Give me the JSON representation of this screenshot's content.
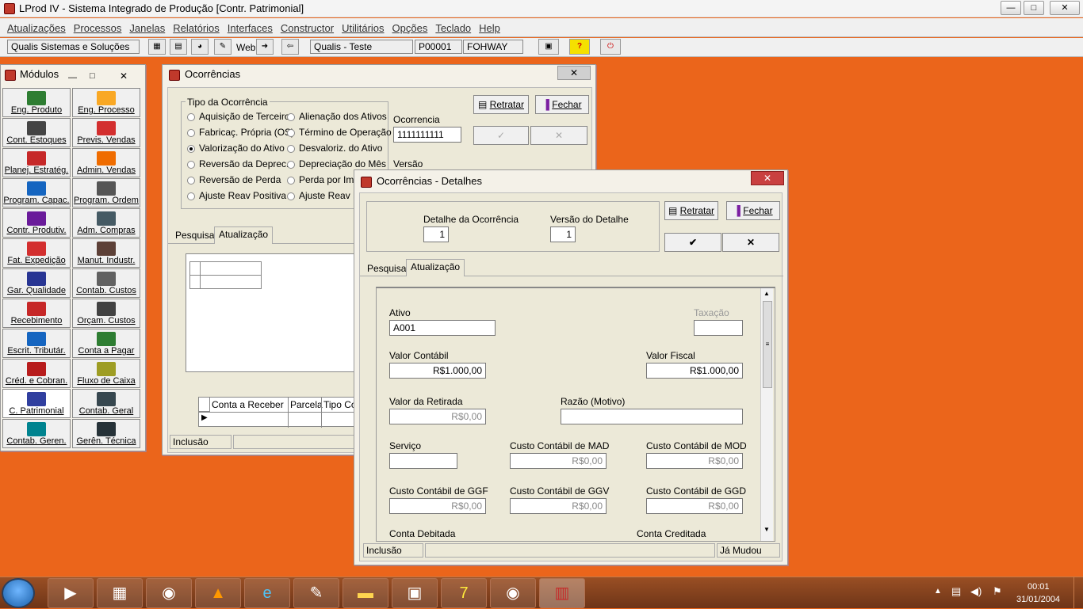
{
  "app": {
    "title": "LProd IV - Sistema Integrado de Produção [Contr. Patrimonial]"
  },
  "menu": [
    "Atualizações",
    "Processos",
    "Janelas",
    "Relatórios",
    "Interfaces",
    "Constructor",
    "Utilitários",
    "Opções",
    "Teclado",
    "Help"
  ],
  "toolbar": {
    "company": "Qualis Sistemas e Soluções",
    "web_label": "Web",
    "env": "Qualis - Teste",
    "code": "P00001",
    "user": "FOHWAY"
  },
  "modules": {
    "title": "Módulos",
    "items": [
      {
        "label": "Eng. Produto",
        "color": "#2e7d32"
      },
      {
        "label": "Eng. Processo",
        "color": "#f9a825"
      },
      {
        "label": "Cont. Estoques",
        "color": "#444444"
      },
      {
        "label": "Previs. Vendas",
        "color": "#d32f2f"
      },
      {
        "label": "Planej. Estratég.",
        "color": "#c62828"
      },
      {
        "label": "Admin. Vendas",
        "color": "#ef6c00"
      },
      {
        "label": "Program. Capac.",
        "color": "#1565c0"
      },
      {
        "label": "Program. Ordem",
        "color": "#555555"
      },
      {
        "label": "Contr. Produtiv.",
        "color": "#6a1b9a"
      },
      {
        "label": "Adm. Compras",
        "color": "#455a64"
      },
      {
        "label": "Fat. Expedição",
        "color": "#d32f2f"
      },
      {
        "label": "Manut. Industr.",
        "color": "#5d4037"
      },
      {
        "label": "Gar. Qualidade",
        "color": "#283593"
      },
      {
        "label": "Contab. Custos",
        "color": "#616161"
      },
      {
        "label": "Recebimento",
        "color": "#c62828"
      },
      {
        "label": "Orçam. Custos",
        "color": "#424242"
      },
      {
        "label": "Escrit. Tributár.",
        "color": "#1565c0"
      },
      {
        "label": "Conta a Pagar",
        "color": "#2e7d32"
      },
      {
        "label": "Créd. e Cobran.",
        "color": "#b71c1c"
      },
      {
        "label": "Fluxo de Caixa",
        "color": "#9e9d24"
      },
      {
        "label": "C. Patrimonial",
        "color": "#303f9f"
      },
      {
        "label": "Contab. Geral",
        "color": "#37474f"
      },
      {
        "label": "Contab. Geren.",
        "color": "#00838f"
      },
      {
        "label": "Gerên. Técnica",
        "color": "#263238"
      }
    ]
  },
  "ocorrencias": {
    "title": "Ocorrências",
    "group_label": "Tipo da Ocorrência",
    "radios_left": [
      "Aquisição de Terceiro",
      "Fabricaç. Própria (OS)",
      "Valorização do Ativo",
      "Reversão da Deprec.",
      "Reversão de Perda",
      "Ajuste Reav Positiva"
    ],
    "radios_right": [
      "Alienação dos Ativos",
      "Término de Operação",
      "Desvaloriz. do Ativo",
      "Depreciação do Mês",
      "Perda por Imp",
      "Ajuste Reav N"
    ],
    "selected": "Valorização do Ativo",
    "ocorrencia_label": "Ocorrencia",
    "ocorrencia_value": "1111111111",
    "versao_label": "Versão",
    "retratar": "Retratar",
    "fechar": "Fechar",
    "tabs": [
      "Pesquisa",
      "Atualização"
    ],
    "grid_headers": [
      "Conta a Receber",
      "Parcela",
      "Tipo Co"
    ],
    "status": "Inclusão"
  },
  "detalhes": {
    "title": "Ocorrências - Detalhes",
    "detalhe_label": "Detalhe da Ocorrência",
    "detalhe_value": "1",
    "versao_label": "Versão do Detalhe",
    "versao_value": "1",
    "retratar": "Retratar",
    "fechar": "Fechar",
    "ok_symbol": "✔",
    "cancel_symbol": "✕",
    "tabs": [
      "Pesquisa",
      "Atualização"
    ],
    "ativo_label": "Ativo",
    "ativo_value": "A001",
    "taxacao_label": "Taxação",
    "valor_contabil_label": "Valor Contábil",
    "valor_contabil": "R$1.000,00",
    "valor_fiscal_label": "Valor Fiscal",
    "valor_fiscal": "R$1.000,00",
    "valor_retirada_label": "Valor da Retirada",
    "valor_retirada": "R$0,00",
    "razao_label": "Razão (Motivo)",
    "servico_label": "Serviço",
    "mad_label": "Custo Contábil de MAD",
    "mad": "R$0,00",
    "mod_label": "Custo Contábil de MOD",
    "mod": "R$0,00",
    "ggf_label": "Custo Contábil de GGF",
    "ggf": "R$0,00",
    "ggv_label": "Custo Contábil de GGV",
    "ggv": "R$0,00",
    "ggd_label": "Custo Contábil de GGD",
    "ggd": "R$0,00",
    "debitada_label": "Conta Debitada",
    "creditada_label": "Conta Creditada",
    "status": "Inclusão",
    "status_right": "Já Mudou"
  },
  "taskbar": {
    "time": "00:01",
    "date": "31/01/2004"
  }
}
